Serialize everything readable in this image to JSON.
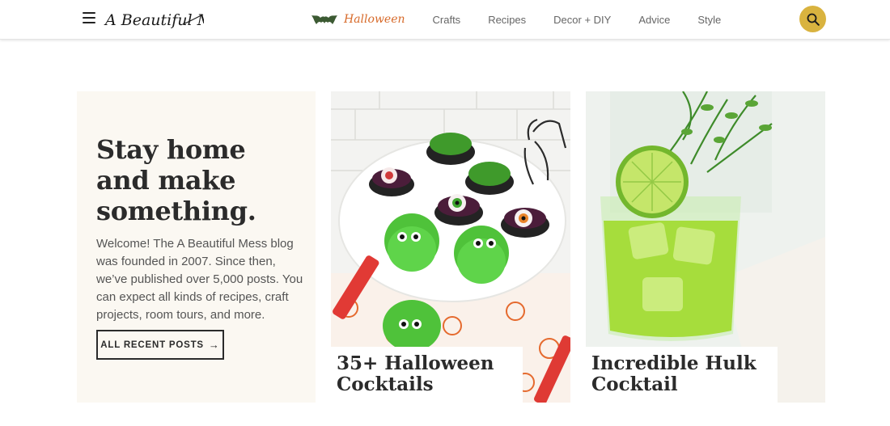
{
  "header": {
    "logo_text": "A Beautiful Mess",
    "nav": {
      "halloween_label": "Halloween",
      "links": [
        "Crafts",
        "Recipes",
        "Decor + DIY",
        "Advice",
        "Style"
      ]
    },
    "icons": {
      "menu": "hamburger-menu-icon",
      "search": "search-icon",
      "halloween": "bat-icon"
    },
    "colors": {
      "halloween": "#d76a2a",
      "search_bg": "#d9b33f",
      "bat": "#3c5a33"
    }
  },
  "intro": {
    "title": "Stay home and make something.",
    "body": "Welcome! The A Beautiful Mess blog was founded in 2007. Since then, we’ve published over 5,000 posts. You can expect all kinds of recipes, craft projects, room tours, and more.",
    "button_label": "ALL RECENT POSTS",
    "button_arrow": "→"
  },
  "posts": [
    {
      "title": "35+ Halloween Cocktails"
    },
    {
      "title": "Incredible Hulk Cocktail"
    }
  ]
}
